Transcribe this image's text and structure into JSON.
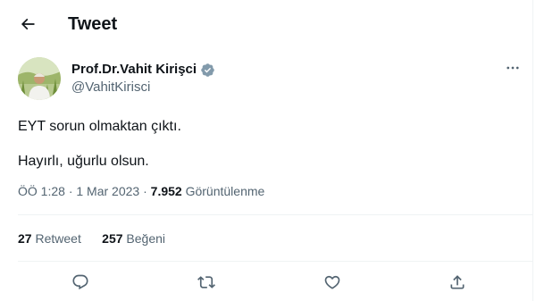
{
  "header": {
    "title": "Tweet",
    "back_icon": "arrow-left-icon"
  },
  "author": {
    "display_name": "Prof.Dr.Vahit Kirişci",
    "username": "@VahitKirisci",
    "verified": true,
    "verified_color": "#829aab"
  },
  "tweet": {
    "lines": [
      "EYT sorun olmaktan çıktı.",
      "Hayırlı, uğurlu olsun."
    ],
    "time": "ÖÖ 1:28",
    "separator": "·",
    "date": "1 Mar 2023",
    "views_count": "7.952",
    "views_label": "Görüntülenme"
  },
  "stats": {
    "retweets_count": "27",
    "retweets_label": "Retweet",
    "likes_count": "257",
    "likes_label": "Beğeni"
  },
  "actions": [
    "reply-icon",
    "retweet-icon",
    "like-icon",
    "share-icon"
  ],
  "colors": {
    "text": "#0f1419",
    "secondary": "#536471",
    "border": "#eff3f4"
  }
}
